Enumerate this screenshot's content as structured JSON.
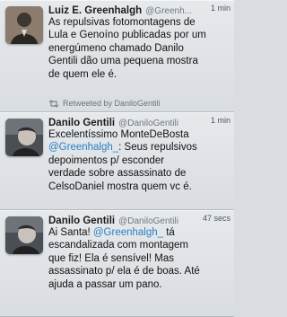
{
  "tweets": [
    {
      "name": "Luiz E. Greenhalgh",
      "handle": "@Greenh...",
      "time": "1 min",
      "text": "As repulsivas fotomontagens de\nLula e Genoíno publicadas por um\nenergúmeno chamado Danilo\nGentili dão uma pequena mostra\nde quem ele é.",
      "retweeted_by": "Retweeted by DaniloGentili"
    },
    {
      "name": "Danilo Gentili",
      "handle": "@DaniloGentili",
      "time": "1 min",
      "text_before": "Excelentíssimo MonteDeBosta\n",
      "mention": "@Greenhalgh_",
      "text_after": ": Seus repulsivos\ndepoimentos p/ esconder\nverdade sobre assassinato de\nCelsoDaniel mostra quem vc é."
    },
    {
      "name": "Danilo Gentili",
      "handle": "@DaniloGentili",
      "time": "47 secs",
      "text_before": "Ai Santa! ",
      "mention": "@Greenhalgh_",
      "text_after": " tá\nescandalizada com montagem\nque fiz! Ela é sensível! Mas\nassassinato p/ ela é de boas. Até\najuda a passar um pano."
    }
  ],
  "colors": {
    "background": "#d9dde1",
    "mention": "#2a80c4",
    "text": "#111111",
    "meta": "#6f7780"
  }
}
